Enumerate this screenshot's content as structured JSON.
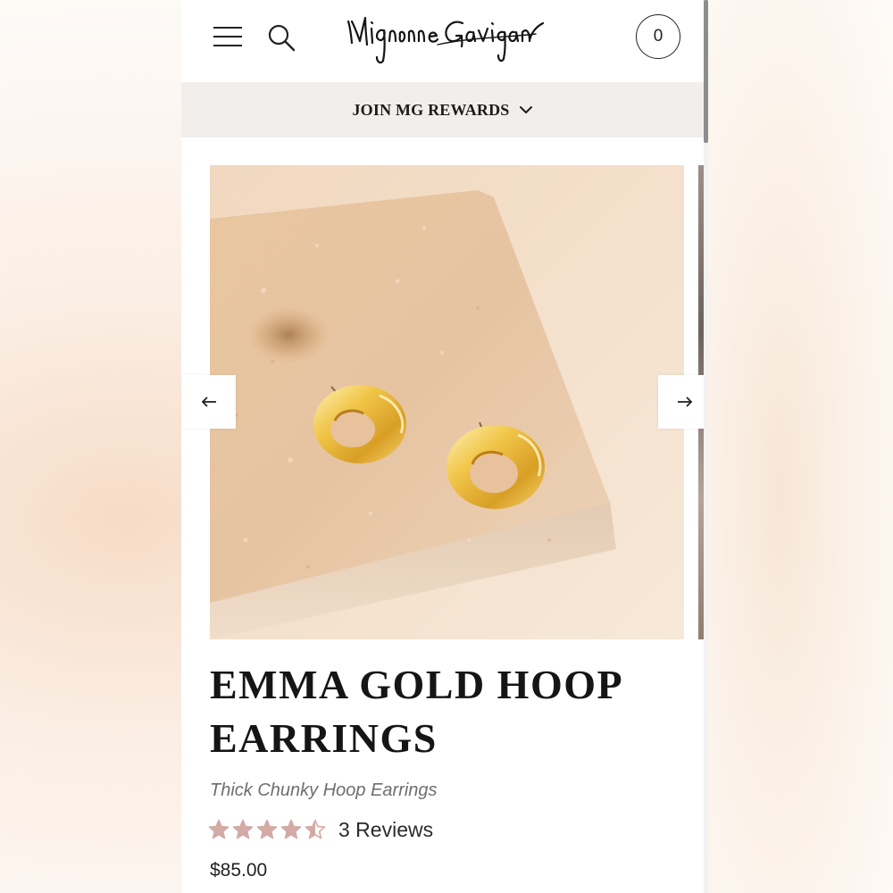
{
  "header": {
    "brand": "Mignonne Gavigan",
    "cart_count": "0"
  },
  "rewards_bar": {
    "label": "JOIN MG REWARDS"
  },
  "product": {
    "title": "EMMA GOLD HOOP EARRINGS",
    "subtitle": "Thick Chunky Hoop Earrings",
    "rating": 4.5,
    "rating_max": 5,
    "reviews_label": "3 Reviews",
    "price": "$85.00"
  },
  "carousel": {
    "prev_icon": "arrow-left-icon",
    "next_icon": "arrow-right-icon"
  },
  "colors": {
    "star": "#d3aaa5",
    "rewards_bg": "#f2eeeb",
    "text": "#151515"
  }
}
